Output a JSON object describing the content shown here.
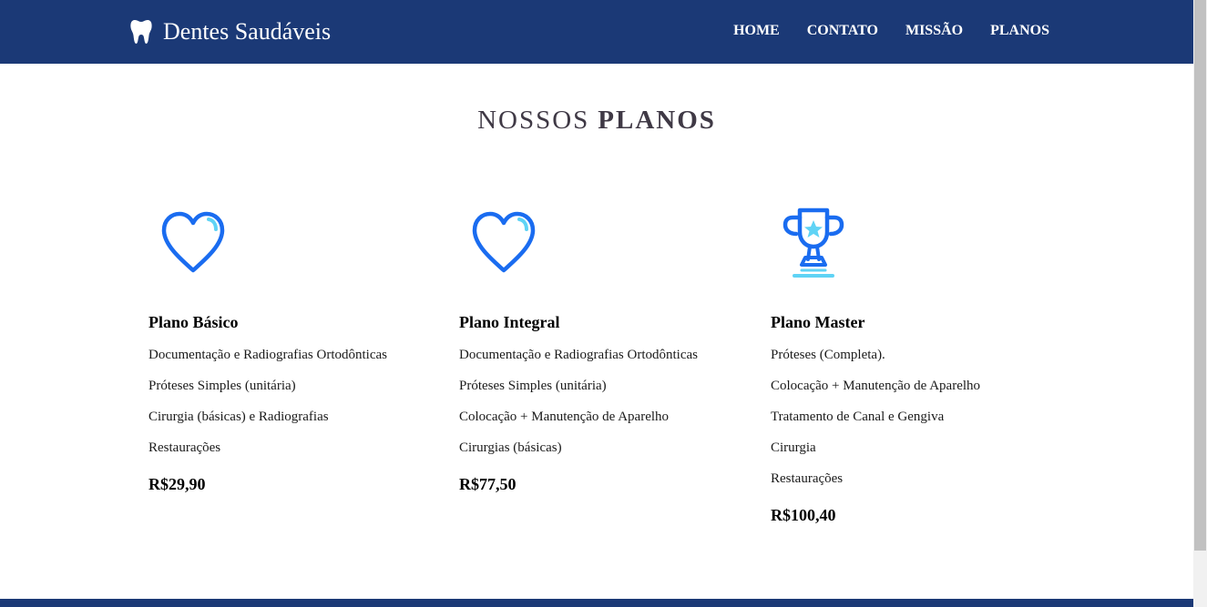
{
  "brand": {
    "name": "Dentes Saudáveis",
    "icon": "tooth-icon"
  },
  "nav": {
    "items": [
      "HOME",
      "CONTATO",
      "MISSÃO",
      "PLANOS"
    ]
  },
  "section": {
    "title_light": "NOSSOS",
    "title_bold": "PLANOS"
  },
  "colors": {
    "header": "#1b3976",
    "icon_primary": "#1a6cf0",
    "icon_accent": "#5fd3f5",
    "title": "#3f3945"
  },
  "plans": [
    {
      "name": "Plano Básico",
      "icon": "heart-icon",
      "features": [
        "Documentação e Radiografias Ortodônticas",
        "Próteses Simples (unitária)",
        "Cirurgia (básicas) e Radiografias",
        "Restaurações"
      ],
      "price": "R$29,90"
    },
    {
      "name": "Plano Integral",
      "icon": "heart-icon",
      "features": [
        "Documentação e Radiografias Ortodônticas",
        "Próteses Simples (unitária)",
        "Colocação + Manutenção de Aparelho",
        "Cirurgias (básicas)"
      ],
      "price": "R$77,50"
    },
    {
      "name": "Plano Master",
      "icon": "trophy-icon",
      "features": [
        "Próteses (Completa).",
        "Colocação + Manutenção de Aparelho",
        "Tratamento de Canal e Gengiva",
        "Cirurgia",
        "Restaurações"
      ],
      "price": "R$100,40"
    }
  ]
}
